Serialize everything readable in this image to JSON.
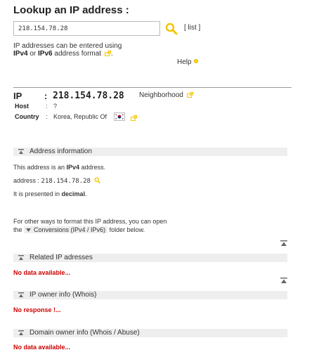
{
  "header": {
    "title": "Lookup an IP address :"
  },
  "search": {
    "value": "218.154.78.28",
    "list_label": "[ list ]"
  },
  "hint": {
    "line1": "IP addresses can be entered using",
    "ipv4": "IPv4",
    "or": " or ",
    "ipv6": "IPv6",
    "suffix": " address format"
  },
  "help": {
    "label": "Help"
  },
  "result": {
    "ip_label": "IP",
    "colon": ":",
    "ip_value": "218.154.78.28",
    "neighborhood_label": "Neighborhood",
    "host_label": "Host",
    "host_value": "?",
    "country_label": "Country",
    "country_value": "Korea, Republic Of"
  },
  "sections": {
    "address_info": {
      "title": "Address information",
      "line1_prefix": "This address is an ",
      "line1_bold": "IPv4",
      "line1_suffix": " address.",
      "address_label": "address : ",
      "address_value": "218.154.78.28",
      "line3_prefix": "It is presented in ",
      "line3_bold": "decimal",
      "line3_suffix": ".",
      "line4": "For other ways to format this IP address, you can open",
      "line5_prefix": "the ",
      "conversions_label": "Conversions (IPv4 / IPv6)",
      "line5_suffix": " folder below."
    },
    "related": {
      "title": "Related IP adresses",
      "status": "No data available..."
    },
    "whois": {
      "title": "IP owner info (Whois)",
      "status": "No response !..."
    },
    "domain": {
      "title": "Domain owner info (Whois / Abuse)",
      "status": "No data available..."
    }
  },
  "colors": {
    "accent_yellow": "#f5c400",
    "error_red": "#cc0000",
    "section_bg": "#eeeeee"
  },
  "icons": {
    "search": "magnifier-icon",
    "external": "external-link-icon",
    "collapse": "collapse-up-icon",
    "flag": "korea-flag-icon"
  }
}
